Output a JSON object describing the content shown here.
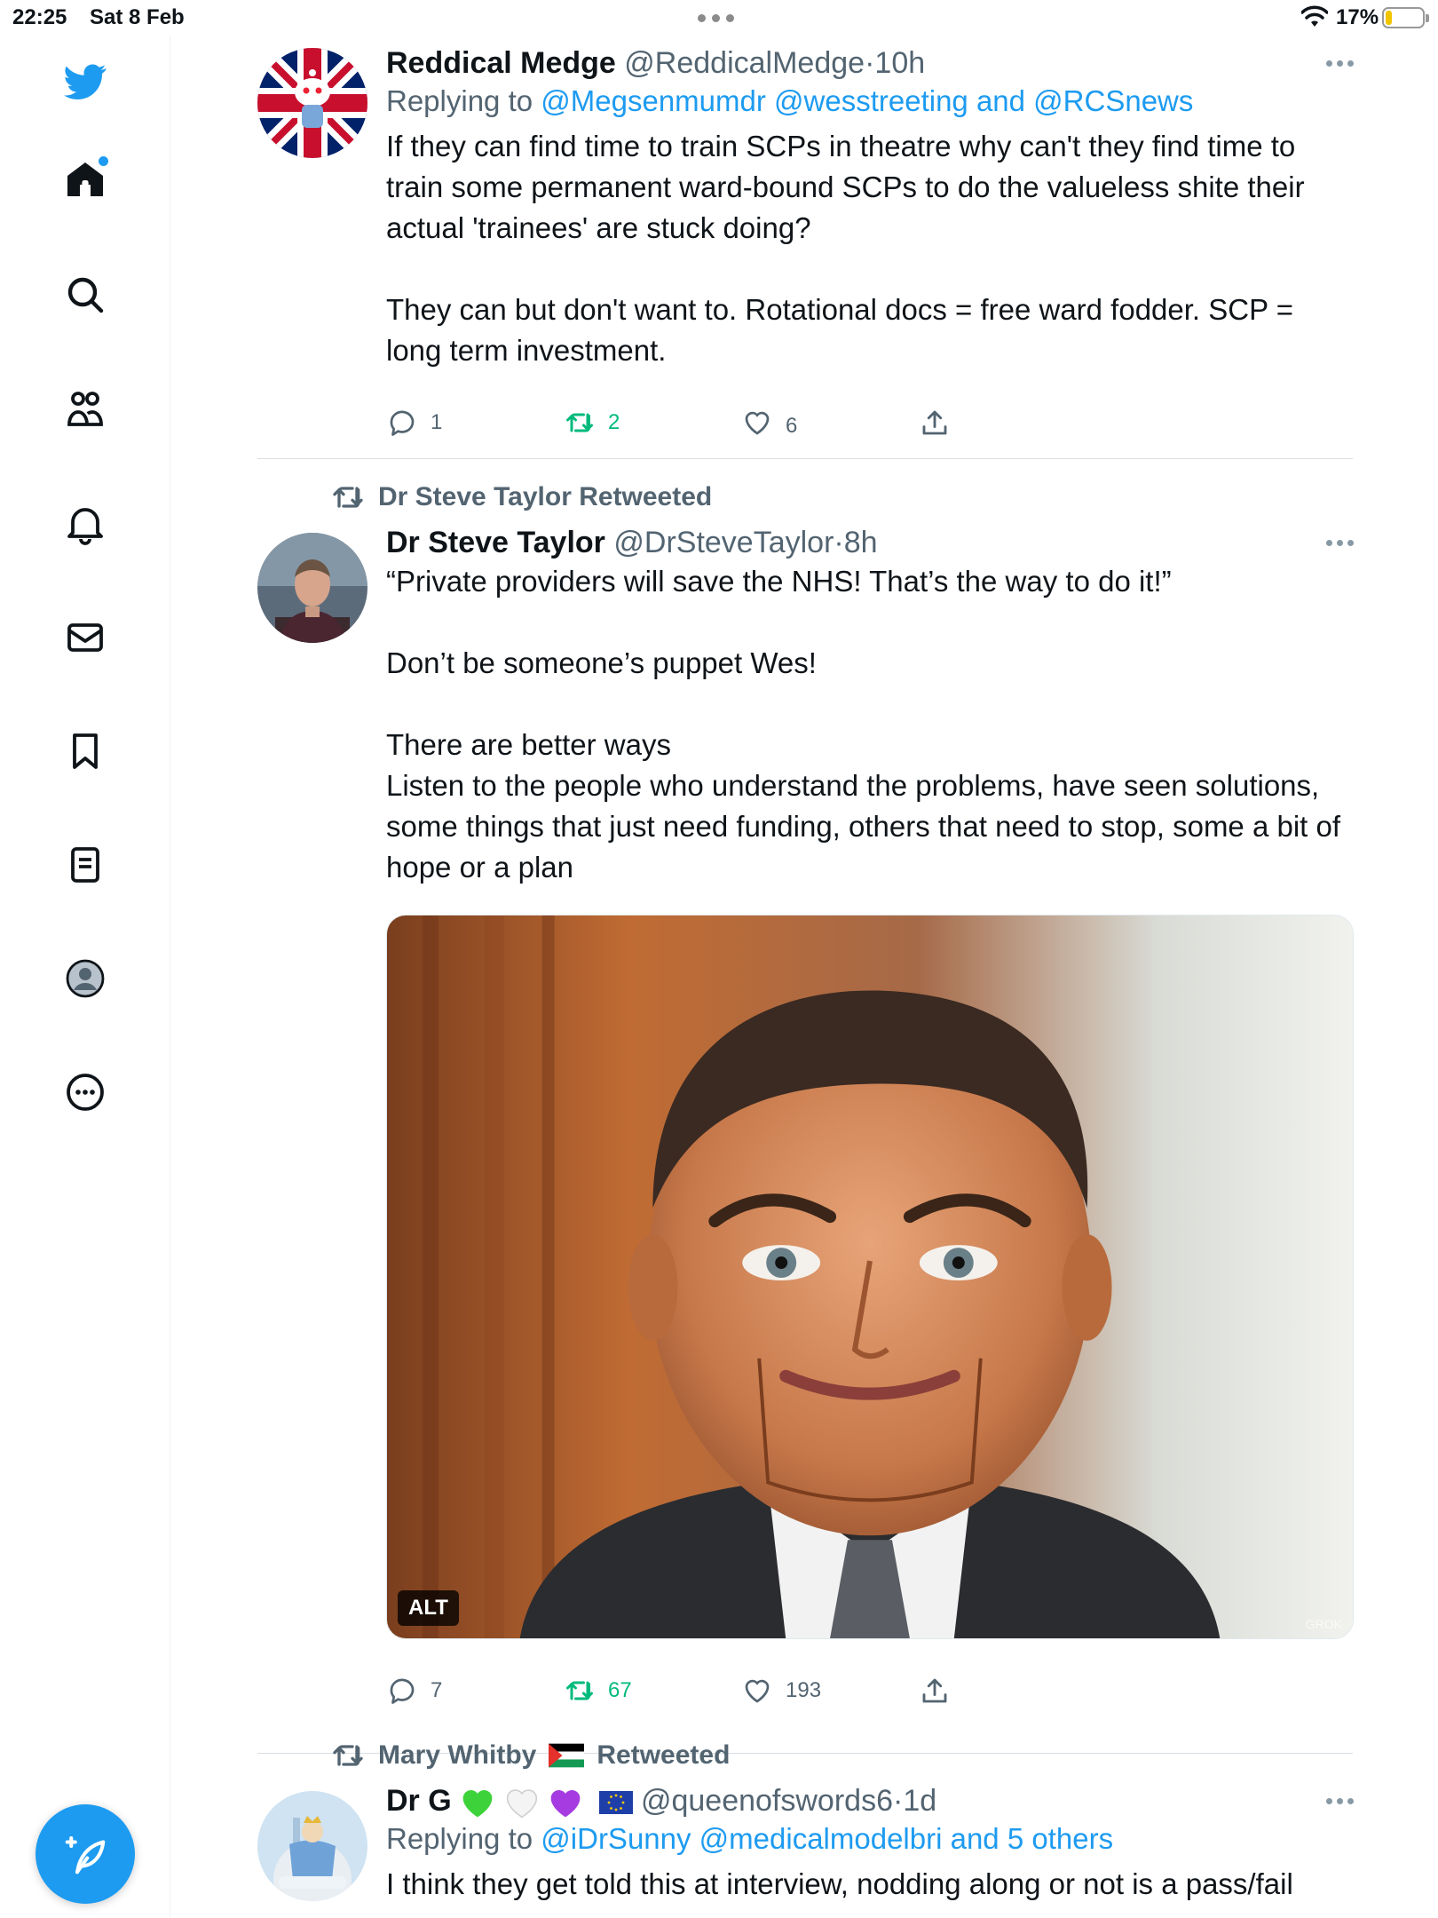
{
  "status_bar": {
    "time": "22:25",
    "date": "Sat 8 Feb",
    "battery_percent": "17%"
  },
  "sidebar": {
    "items": [
      "twitter-logo",
      "home",
      "search",
      "communities",
      "notifications",
      "messages",
      "bookmarks",
      "lists",
      "profile",
      "more"
    ],
    "accent_color": "#1d9bf0"
  },
  "tweets": [
    {
      "name": "Reddical Medge",
      "handle": "@ReddicalMedge",
      "sep": "·",
      "time": "10h",
      "reply_prefix": "Replying to",
      "reply_targets": "@Megsenmumdr @wesstreeting and @RCSnews",
      "text": "If they can find time to train SCPs in theatre why can't they find time to train some permanent ward-bound SCPs to do the valueless shite their actual 'trainees' are stuck doing?\n\nThey can but don't want to. Rotational docs = free ward fodder. SCP = long term investment.",
      "replies": "1",
      "retweets": "2",
      "likes": "6"
    },
    {
      "retweeted_by": "Dr Steve Taylor Retweeted",
      "name": "Dr Steve Taylor",
      "handle": "@DrSteveTaylor",
      "sep": "·",
      "time": "8h",
      "text": "“Private providers will save the NHS! That’s the way to do it!”\n\nDon’t be someone’s puppet Wes!\n\nThere are better ways\nListen to the people who understand the problems, have seen solutions, some things that just need funding, others that need to stop, some a bit of hope or a plan",
      "media_alt_badge": "ALT",
      "media_watermark": "GROK",
      "replies": "7",
      "retweets": "67",
      "likes": "193"
    },
    {
      "retweeted_by_name": "Mary Whitby",
      "retweeted_by_suffix": "Retweeted",
      "name": "Dr G",
      "handle": "@queenofswords6",
      "sep": "·",
      "time": "1d",
      "reply_prefix": "Replying to",
      "reply_targets": "@iDrSunny @medicalmodelbri and 5 others",
      "text": "I think they get told this at interview, nodding along or not is a pass/fail"
    }
  ]
}
